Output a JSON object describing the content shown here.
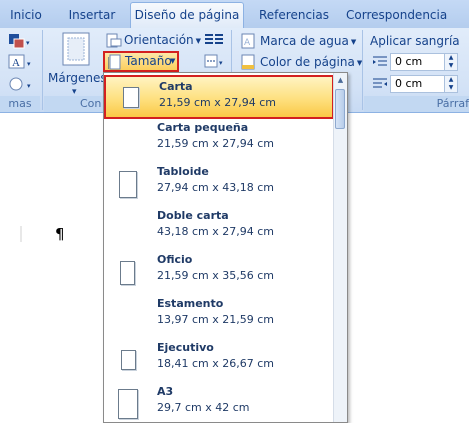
{
  "tabs": [
    {
      "label": "Inicio"
    },
    {
      "label": "Insertar"
    },
    {
      "label": "Diseño de página"
    },
    {
      "label": "Referencias"
    },
    {
      "label": "Correspondencia"
    }
  ],
  "ribbon": {
    "temas_label_fragment": "mas",
    "margenes_label": "Márgenes",
    "configurar_label_fragment": "Con",
    "orientacion_label": "Orientación",
    "tamano_label": "Tamaño",
    "marca_agua_label": "Marca de agua",
    "color_pagina_label": "Color de página",
    "aplicar_sangria_label": "Aplicar sangría",
    "indent_left_value": "0 cm",
    "indent_right_value": "0 cm",
    "parrafo_label_fragment": "Párraf"
  },
  "document": {
    "pilcrow": "¶"
  },
  "paper_sizes": [
    {
      "name": "Carta",
      "size": "21,59 cm x 27,94 cm",
      "selected": true
    },
    {
      "name": "Carta pequeña",
      "size": "21,59 cm x 27,94 cm",
      "selected": false
    },
    {
      "name": "Tabloide",
      "size": "27,94 cm x 43,18 cm",
      "selected": false
    },
    {
      "name": "Doble carta",
      "size": "43,18 cm x 27,94 cm",
      "selected": false
    },
    {
      "name": "Oficio",
      "size": "21,59 cm x 35,56 cm",
      "selected": false
    },
    {
      "name": "Estamento",
      "size": "13,97 cm x 21,59 cm",
      "selected": false
    },
    {
      "name": "Ejecutivo",
      "size": "18,41 cm x 26,67 cm",
      "selected": false
    },
    {
      "name": "A3",
      "size": "29,7 cm x 42 cm",
      "selected": false
    }
  ],
  "colors": {
    "highlight_border": "#d32020",
    "ribbon_text": "#15428b"
  }
}
